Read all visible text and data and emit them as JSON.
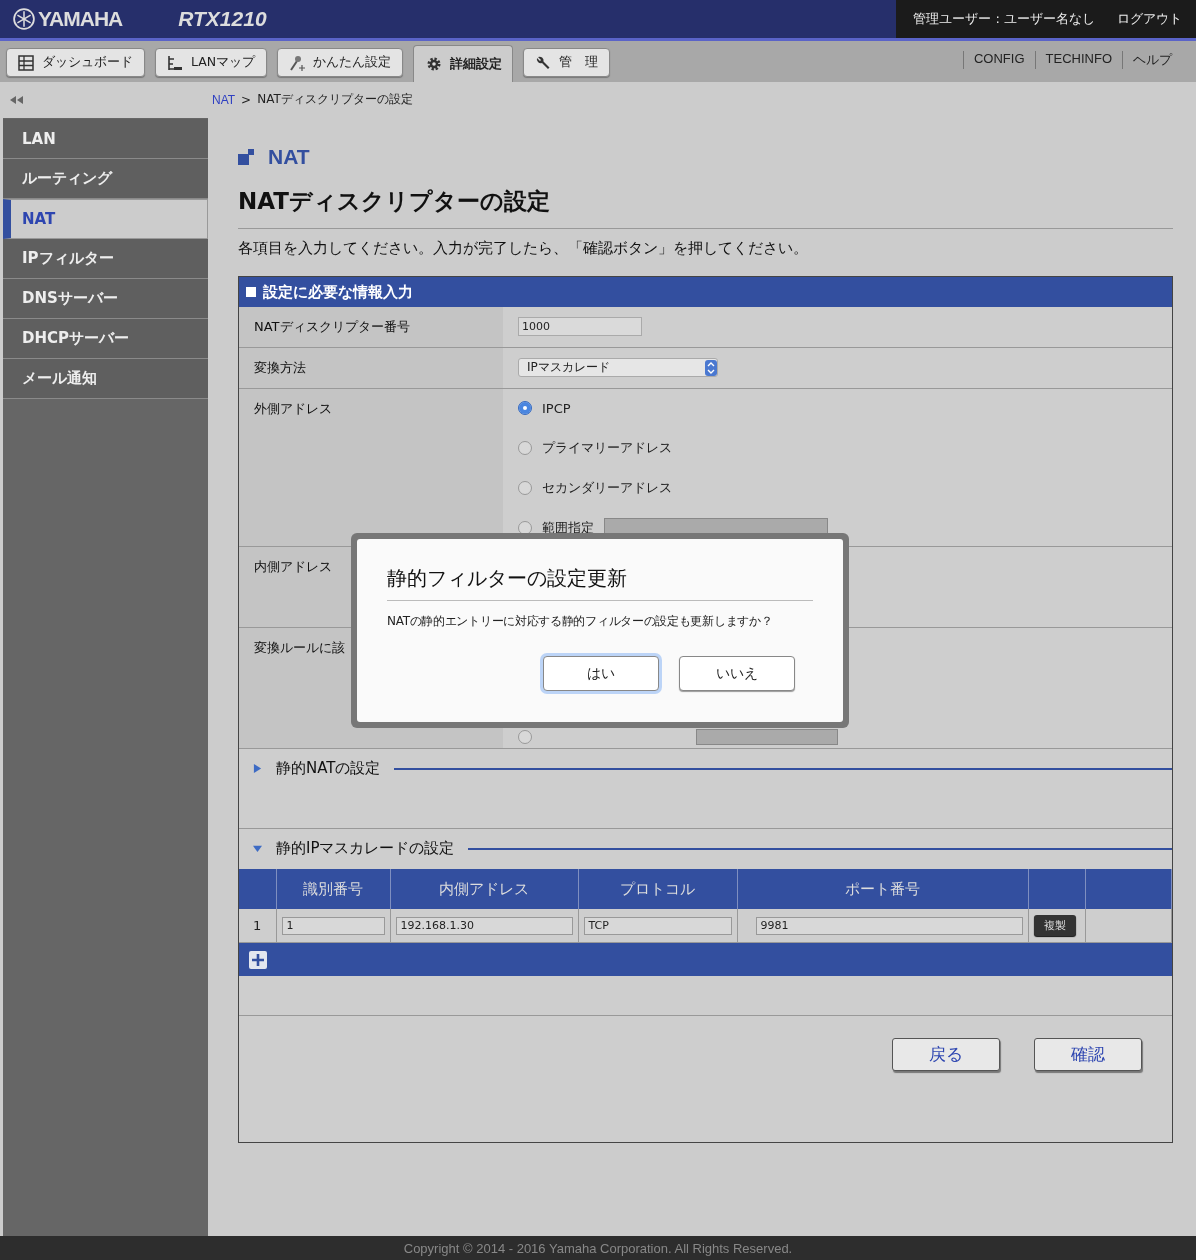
{
  "header": {
    "brand": "YAMAHA",
    "model": "RTX1210",
    "user": "管理ユーザー : ユーザー名なし",
    "logout": "ログアウト"
  },
  "tabs": [
    {
      "label": "ダッシュボード",
      "selected": false
    },
    {
      "label": "LANマップ",
      "selected": false
    },
    {
      "label": "かんたん設定",
      "selected": false
    },
    {
      "label": "詳細設定",
      "selected": true
    },
    {
      "label": "管　理",
      "selected": false
    }
  ],
  "links": [
    "CONFIG",
    "TECHINFO",
    "ヘルプ"
  ],
  "breadcrumb": {
    "parent": "NAT",
    "separator": ">",
    "current": "NATディスクリプターの設定"
  },
  "sidebar": {
    "items": [
      {
        "label": "LAN",
        "selected": false
      },
      {
        "label": "ルーティング",
        "selected": false
      },
      {
        "label": "NAT",
        "selected": true
      },
      {
        "label": "IPフィルター",
        "selected": false
      },
      {
        "label": "DNSサーバー",
        "selected": false
      },
      {
        "label": "DHCPサーバー",
        "selected": false
      },
      {
        "label": "メール通知",
        "selected": false
      }
    ]
  },
  "page": {
    "section": "NAT",
    "title": "NATディスクリプターの設定",
    "instruction": "各項目を入力してください。入力が完了したら、「確認ボタン」を押してください。"
  },
  "form": {
    "header": "設定に必要な情報入力",
    "rows": [
      {
        "label": "NATディスクリプター番号",
        "kind": "text",
        "value": "1000"
      },
      {
        "label": "変換方法",
        "kind": "select",
        "value": "IPマスカレード"
      },
      {
        "label": "外側アドレス",
        "kind": "radios",
        "options": [
          {
            "label": "IPCP",
            "selected": true,
            "field": false
          },
          {
            "label": "プライマリーアドレス",
            "selected": false,
            "field": false
          },
          {
            "label": "セカンダリーアドレス",
            "selected": false,
            "field": false
          },
          {
            "label": "範囲指定",
            "selected": false,
            "field": true
          }
        ]
      },
      {
        "label": "内側アドレス",
        "kind": "covered"
      },
      {
        "label": "変換ルールに該",
        "kind": "radios",
        "options": [
          {
            "selected": false,
            "field": true
          }
        ]
      }
    ],
    "sections": [
      {
        "title": "静的NATの設定",
        "expanded": false
      },
      {
        "title": "静的IPマスカレードの設定",
        "expanded": true,
        "table": {
          "columns": [
            "識別番号",
            "内側アドレス",
            "プロトコル",
            "ポート番号"
          ],
          "rows": [
            {
              "index": "1",
              "values": [
                "1",
                "192.168.1.30",
                "TCP",
                "9981"
              ],
              "action": "複製"
            }
          ]
        }
      }
    ],
    "buttons": [
      "戻る",
      "確認"
    ]
  },
  "dialog": {
    "title": "静的フィルターの設定更新",
    "message": "NATの静的エントリーに対応する静的フィルターの設定も更新しますか？",
    "buttons": [
      {
        "label": "はい",
        "focused": true
      },
      {
        "label": "いいえ",
        "focused": false
      }
    ]
  },
  "footer": "Copyright © 2014 - 2016 Yamaha Corporation. All Rights Reserved."
}
